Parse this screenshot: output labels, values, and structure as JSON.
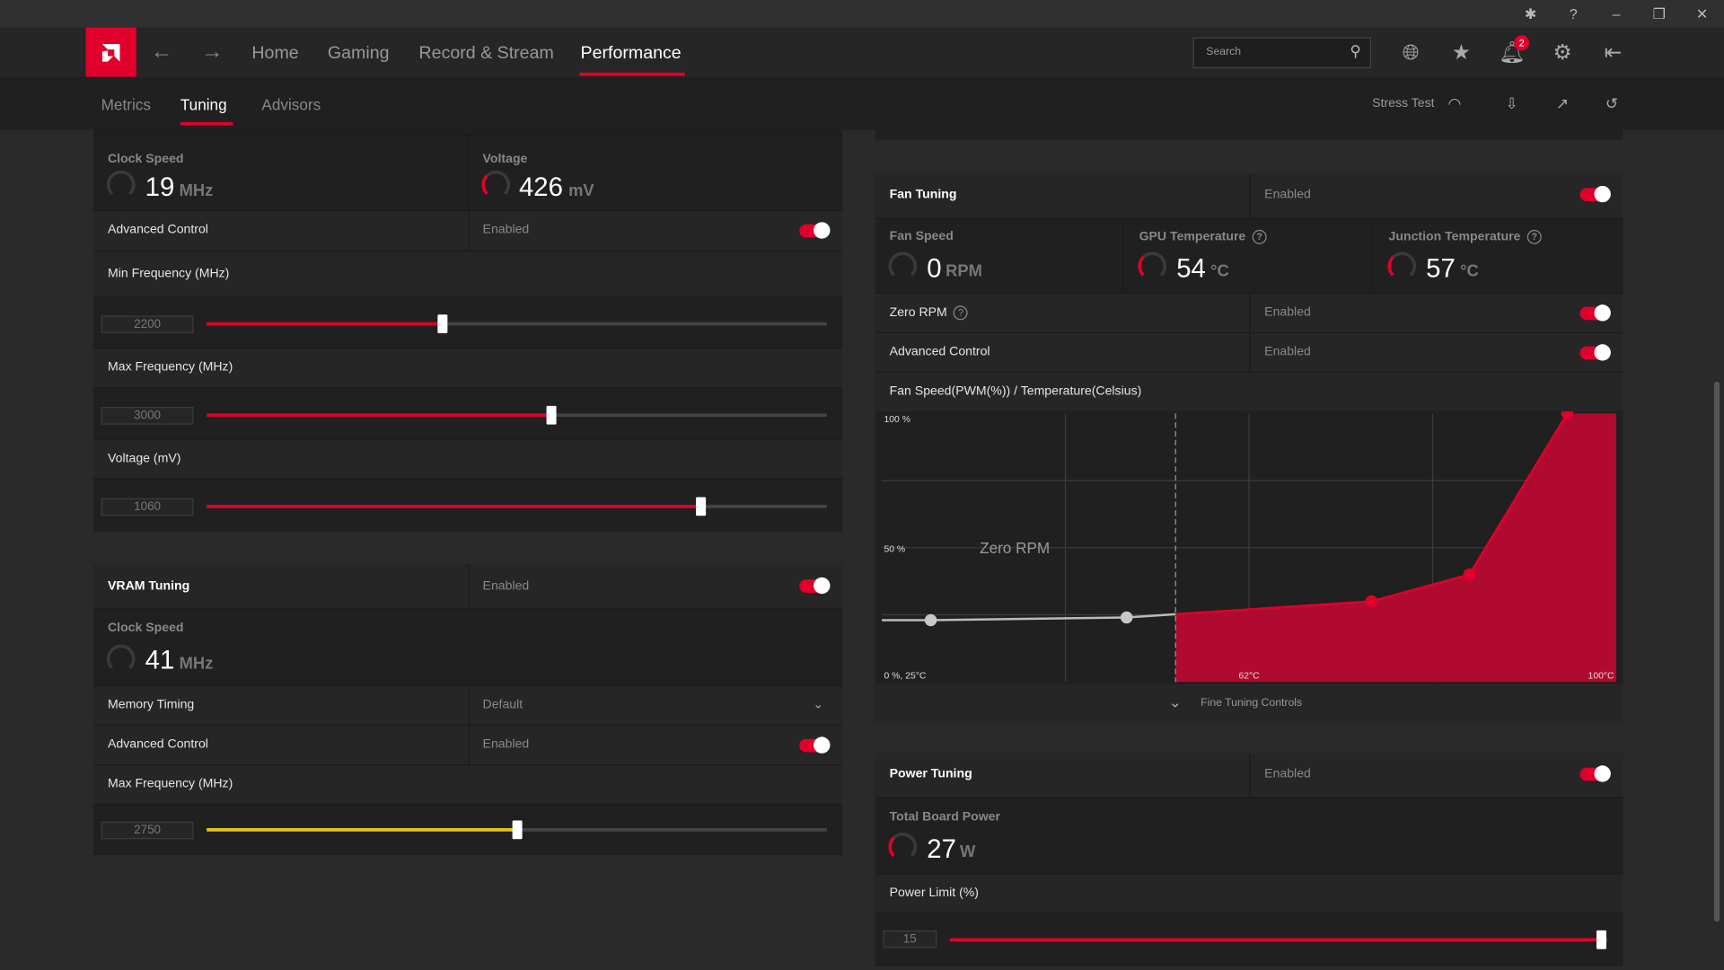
{
  "window": {
    "controls": [
      "bug-icon",
      "help-icon",
      "minimize-icon",
      "restore-icon",
      "close-icon"
    ]
  },
  "nav": {
    "items": [
      "Home",
      "Gaming",
      "Record & Stream",
      "Performance"
    ],
    "active": "Performance",
    "search_placeholder": "Search",
    "notification_count": "2"
  },
  "subnav": {
    "tabs": [
      "Metrics",
      "Tuning",
      "Advisors"
    ],
    "active": "Tuning",
    "stress_test": "Stress Test"
  },
  "colors": {
    "accent": "#e0002b",
    "vram_slider": "#e8c31a"
  },
  "gpu": {
    "clock_label": "Clock Speed",
    "clock_value": "19",
    "clock_unit": "MHz",
    "voltage_label": "Voltage",
    "voltage_value": "426",
    "voltage_unit": "mV",
    "advanced_label": "Advanced Control",
    "advanced_state": "Enabled",
    "sliders": [
      {
        "label": "Min Frequency (MHz)",
        "value": "2200",
        "fraction": 0.38
      },
      {
        "label": "Max Frequency (MHz)",
        "value": "3000",
        "fraction": 0.555
      },
      {
        "label": "Voltage (mV)",
        "value": "1060",
        "fraction": 0.796
      }
    ]
  },
  "vram": {
    "title": "VRAM Tuning",
    "state": "Enabled",
    "clock_label": "Clock Speed",
    "clock_value": "41",
    "clock_unit": "MHz",
    "timing_label": "Memory Timing",
    "timing_value": "Default",
    "advanced_label": "Advanced Control",
    "advanced_state": "Enabled",
    "slider": {
      "label": "Max Frequency (MHz)",
      "value": "2750",
      "fraction": 0.5
    }
  },
  "fan": {
    "title": "Fan Tuning",
    "state": "Enabled",
    "metrics": [
      {
        "label": "Fan Speed",
        "value": "0",
        "unit": "RPM"
      },
      {
        "label": "GPU Temperature",
        "value": "54",
        "unit": "°C"
      },
      {
        "label": "Junction Temperature",
        "value": "57",
        "unit": "°C"
      }
    ],
    "zero_rpm_label": "Zero RPM",
    "zero_rpm_state": "Enabled",
    "advanced_label": "Advanced Control",
    "advanced_state": "Enabled",
    "chart_title": "Fan Speed(PWM(%)) / Temperature(Celsius)",
    "fine_tuning": "Fine Tuning Controls"
  },
  "power": {
    "title": "Power Tuning",
    "state": "Enabled",
    "tbp_label": "Total Board Power",
    "tbp_value": "27",
    "tbp_unit": "W",
    "limit_label": "Power Limit (%)",
    "limit_value": "15",
    "limit_fraction": 0.99
  },
  "chart_data": {
    "type": "area",
    "title": "Fan Speed(PWM(%)) / Temperature(Celsius)",
    "xlim": [
      25,
      100
    ],
    "ylim": [
      0,
      100
    ],
    "grid": true,
    "tick_labels": {
      "origin": "0 %, 25°C",
      "y_top": "100 %",
      "y_mid": "50 %",
      "x_mid": "62°C",
      "x_right": "100°C"
    },
    "annotation": "Zero RPM",
    "zero_rpm_threshold": 55,
    "points": [
      {
        "x": 30,
        "y": 23
      },
      {
        "x": 50,
        "y": 24
      },
      {
        "x": 75,
        "y": 30
      },
      {
        "x": 85,
        "y": 40
      },
      {
        "x": 95,
        "y": 100
      }
    ]
  }
}
